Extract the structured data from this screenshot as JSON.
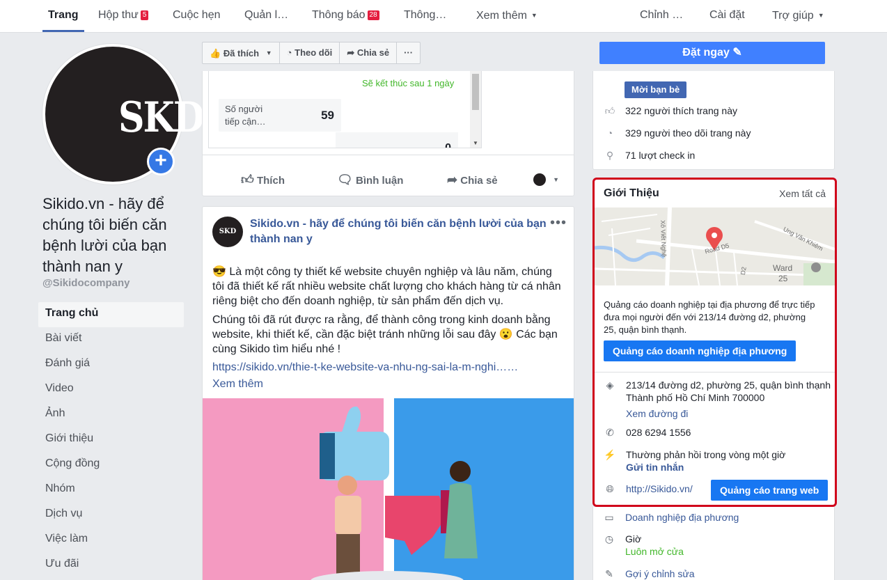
{
  "topnav": {
    "items": [
      {
        "label": "Trang",
        "badge": ""
      },
      {
        "label": "Hộp thư",
        "badge": "5"
      },
      {
        "label": "Cuộc hẹn",
        "badge": ""
      },
      {
        "label": "Quản l…",
        "badge": ""
      },
      {
        "label": "Thông báo",
        "badge": "28"
      },
      {
        "label": "Thông…",
        "badge": ""
      },
      {
        "label": "Xem thêm",
        "badge": ""
      },
      {
        "label": "Chỉnh …",
        "badge": ""
      },
      {
        "label": "Cài đặt",
        "badge": ""
      },
      {
        "label": "Trợ giúp",
        "badge": ""
      }
    ]
  },
  "profile": {
    "logo_text": "SKD",
    "name": "Sikido.vn - hãy để chúng tôi biến căn bệnh lười của bạn thành nan y",
    "handle": "@Sikidocompany"
  },
  "leftnav": {
    "items": [
      "Trang chủ",
      "Bài viết",
      "Đánh giá",
      "Video",
      "Ảnh",
      "Giới thiệu",
      "Cộng đồng",
      "Nhóm",
      "Dịch vụ",
      "Việc làm",
      "Ưu đãi"
    ]
  },
  "actionbar": {
    "liked": "Đã thích",
    "follow": "Theo dõi",
    "share": "Chia sẻ",
    "more": "···"
  },
  "insight": {
    "ends": "Sẽ kết thúc sau 1 ngày",
    "reach_label": "Số người tiếp cận…",
    "reach_value": "59",
    "second_value": "0"
  },
  "reactions": {
    "like": "Thích",
    "comment": "Bình luận",
    "share": "Chia sẻ"
  },
  "post": {
    "avatar_text": "SKD",
    "author": "Sikido.vn - hãy để chúng tôi biến căn bệnh lười của bạn thành nan y",
    "paragraph1": "😎 Là một công ty thiết kế website chuyên nghiệp và lâu năm, chúng tôi đã thiết kế rất nhiều website chất lượng cho khách hàng từ cá nhân riêng biệt cho đến doanh nghiệp, từ sản phẩm đến dịch vụ.",
    "paragraph2": "Chúng tôi đã rút được ra rằng, để thành công trong kinh doanh bằng website, khi thiết kế, cần đặc biệt tránh những lỗi sau đây 😮 Các bạn cùng Sikido tìm hiểu nhé !",
    "link": "https://sikido.vn/thie-t-ke-website-va-nhu-ng-sai-la-m-nghi……",
    "see_more": "Xem thêm"
  },
  "right": {
    "book_now": "Đặt ngay",
    "invite": "Mời bạn bè",
    "likes": "322 người thích trang này",
    "follows": "329 người theo dõi trang này",
    "checkins": "71 lượt check in"
  },
  "about": {
    "title": "Giới Thiệu",
    "see_all": "Xem tất cả",
    "map_labels": {
      "street1": "Xô Viết Nghệ",
      "road": "Road D5",
      "street2": "Ung Văn Khiêm",
      "ward": "Ward",
      "ward_no": "25",
      "d2": "D2"
    },
    "ad_text": "Quảng cáo doanh nghiệp tại địa phương để trực tiếp đưa mọi người đến với 213/14 đường d2, phường 25, quận bình thạnh.",
    "ad_button": "Quảng cáo doanh nghiệp địa phương",
    "address_line1": "213/14 đường d2, phường 25, quận bình thạnh",
    "address_line2": "Thành phố Hồ Chí Minh 700000",
    "directions": "Xem đường đi",
    "phone": "028 6294 1556",
    "response": "Thường phản hồi trong vòng một giờ",
    "send_message": "Gửi tin nhắn",
    "website": "http://Sikido.vn/",
    "web_ad_button": "Quảng cáo trang web"
  },
  "extra": {
    "category": "Doanh nghiệp địa phương",
    "hours_label": "Giờ",
    "hours_value": "Luôn mở cửa",
    "suggest_edit": "Gợi ý chỉnh sửa"
  },
  "colors": {
    "brand": "#4267b2",
    "book_button": "#4080ff",
    "highlight_border": "#d0021b",
    "badge": "#e41e3f"
  }
}
